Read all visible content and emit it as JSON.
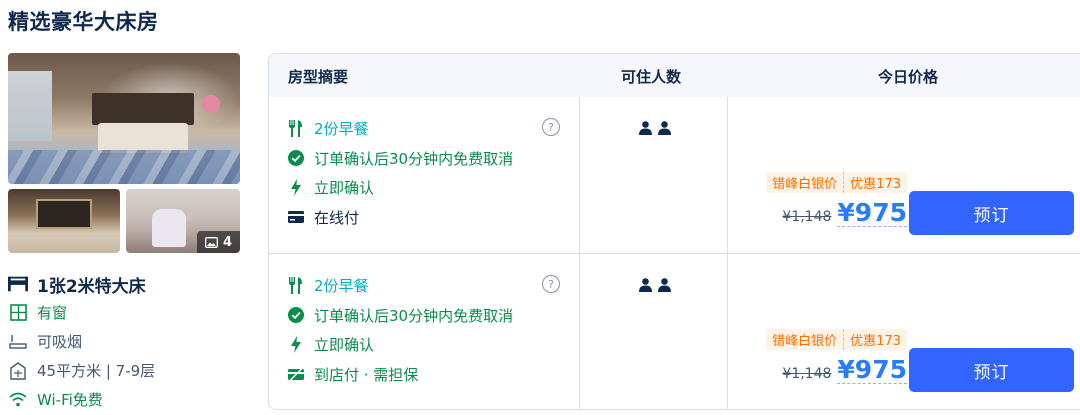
{
  "room": {
    "title": "精选豪华大床房",
    "photos": {
      "count": "4"
    },
    "features": {
      "bed": "1张2米特大床",
      "window": "有窗",
      "smoking": "可吸烟",
      "size_floor": "45平方米 | 7-9层",
      "wifi": "Wi-Fi免费"
    }
  },
  "table": {
    "headers": {
      "summary": "房型摘要",
      "guests": "可住人数",
      "price": "今日价格"
    },
    "rows": [
      {
        "breakfast": "2份早餐",
        "cancel": "订单确认后30分钟内免费取消",
        "confirm": "立即确认",
        "payment": "在线付",
        "promo_a": "错峰白银价",
        "promo_b": "优惠173",
        "old_price": "¥1,148",
        "price": "¥975",
        "book_label": "预订"
      },
      {
        "breakfast": "2份早餐",
        "cancel": "订单确认后30分钟内免费取消",
        "confirm": "立即确认",
        "payment": "到店付 · 需担保",
        "promo_a": "错峰白银价",
        "promo_b": "优惠173",
        "old_price": "¥1,148",
        "price": "¥975",
        "book_label": "预订"
      }
    ]
  },
  "colors": {
    "accent": "#3264ff",
    "price": "#287dfa",
    "green": "#0b8c4d",
    "teal": "#06aebd",
    "promo": "#ff6f00"
  },
  "icons": [
    "bed-icon",
    "window-icon",
    "smoking-icon",
    "area-icon",
    "wifi-icon",
    "utensils-icon",
    "check-circle-icon",
    "lightning-icon",
    "card-icon",
    "pay-at-hotel-icon",
    "help-icon",
    "person-icon",
    "image-icon"
  ]
}
